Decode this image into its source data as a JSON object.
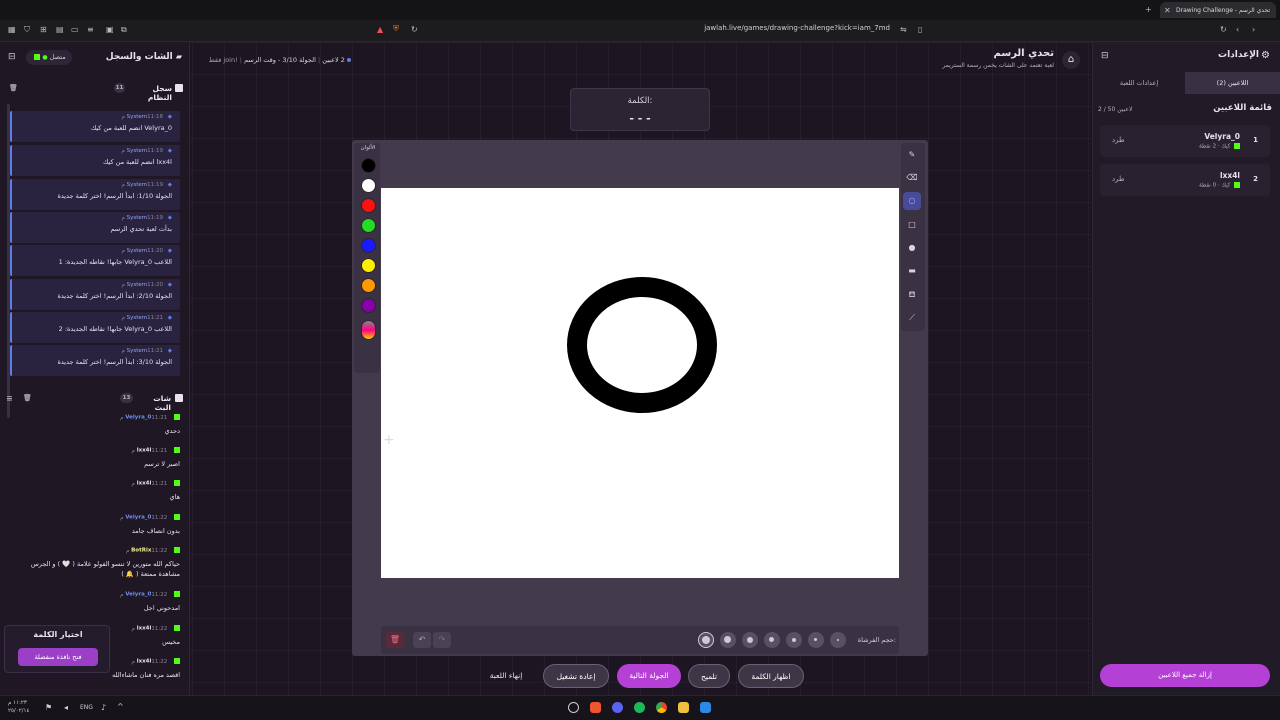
{
  "browser": {
    "tab_title": "تحدي الرسم - Drawing Challenge",
    "url": "jawlah.live/games/drawing-challenge?kick=iam_7md"
  },
  "header": {
    "title": "تحدي الرسم",
    "subtitle": "لعبة تعتمد على الشات يخمن رسمة الستريمر",
    "players_count": "2 لاعبين",
    "round_info": "الجولة 3/10 - وقت الرسم",
    "join_hint": "!join فقط"
  },
  "left_panel": {
    "title": "الشات والسجل",
    "connection_status": "متصل",
    "system_log": {
      "title": "سجل النظام",
      "count": "11",
      "items": [
        {
          "sender": "System",
          "time": "11:18 م",
          "text": "Velyra_0 انضم للعبة من كيك"
        },
        {
          "sender": "System",
          "time": "11:19 م",
          "text": "lxx4l انضم للعبة من كيك"
        },
        {
          "sender": "System",
          "time": "11:19 م",
          "text": "الجولة 1/10: ابدأ الرسم! اختر كلمة جديدة"
        },
        {
          "sender": "System",
          "time": "11:19 م",
          "text": "بدأت لعبة تحدي الرسم"
        },
        {
          "sender": "System",
          "time": "11:20 م",
          "text": "اللاعب Velyra_0 جابها! نقاطه الجديدة: 1"
        },
        {
          "sender": "System",
          "time": "11:20 م",
          "text": "الجولة 2/10: ابدأ الرسم! اختر كلمة جديدة"
        },
        {
          "sender": "System",
          "time": "11:21 م",
          "text": "اللاعب Velyra_0 جابها! نقاطه الجديدة: 2"
        },
        {
          "sender": "System",
          "time": "11:21 م",
          "text": "الجولة 3/10: ابدأ الرسم! اختر كلمة جديدة"
        }
      ]
    },
    "live_chat": {
      "title": "شات البث",
      "count": "13",
      "items": [
        {
          "user": "Velyra_0",
          "time": "11:21 م",
          "text": "دحدي",
          "color": "#6f8ff0"
        },
        {
          "user": "lxx4l",
          "time": "11:21 م",
          "text": "اصبر لا ترسم",
          "color": "#e6e0ee"
        },
        {
          "user": "lxx4l",
          "time": "11:21 م",
          "text": "هاي",
          "color": "#e6e0ee"
        },
        {
          "user": "Velyra_0",
          "time": "11:22 م",
          "text": "بدون انصاف جامد",
          "color": "#6f8ff0"
        },
        {
          "user": "BotRix",
          "time": "11:22 م",
          "text": "حياكم الله متورين لا تنسو الفولو علامة ( 🤍 ) و الجرس مشاهدة ممتعة ( 🔔 )",
          "color": "#f5f58a"
        },
        {
          "user": "Velyra_0",
          "time": "11:22 م",
          "text": "امدحوني اجل",
          "color": "#6f8ff0"
        },
        {
          "user": "lxx4l",
          "time": "11:22 م",
          "text": "مخيس",
          "color": "#e6e0ee"
        },
        {
          "user": "lxx4l",
          "time": "11:22 م",
          "text": "اقصد مره فنان ماشاءالله",
          "color": "#e6e0ee"
        }
      ]
    },
    "word_choice": {
      "title": "اختيار الكلمة",
      "button": "فتح نافذة منفصلة"
    }
  },
  "center": {
    "word_label": "الكلمة:",
    "word_mask": "- - -",
    "colors_label": "الألوان",
    "colors": [
      "#000000",
      "#ffffff",
      "#ff1010",
      "#22dd22",
      "#1a1aff",
      "#ffee00",
      "#ff9900",
      "#8800aa"
    ],
    "tools": [
      "pencil-icon",
      "eraser-icon",
      "circle-icon",
      "rectangle-icon",
      "dot-icon",
      "fill-rect-icon",
      "fill-bucket-icon",
      "line-icon"
    ],
    "brush_size_label": "حجم الفرشاة:",
    "bottom_buttons": {
      "end_game": "إنهاء اللعبة",
      "restart": "إعادة تشغيل",
      "next_round": "الجولة التالية",
      "hint": "تلميح",
      "reveal_word": "اظهار الكلمة"
    }
  },
  "right_panel": {
    "title": "الإعدادات",
    "tabs": [
      "اللاعبين (2)",
      "إعدادات اللعبة"
    ],
    "players_title": "قائمة اللاعبين",
    "players_count": "2 / 50 لاعبين",
    "kick_label": "طرد",
    "players": [
      {
        "rank": "1",
        "name": "Velyra_0",
        "points": "2 نقطة",
        "platform": "كيك"
      },
      {
        "rank": "2",
        "name": "lxx4l",
        "points": "0 نقطة",
        "platform": "كيك"
      }
    ],
    "remove_all": "إزالة جميع اللاعبين"
  },
  "taskbar": {
    "time": "١١:٢٣ م",
    "date": "٢٥/٠٢/١٤",
    "lang": "ENG"
  }
}
